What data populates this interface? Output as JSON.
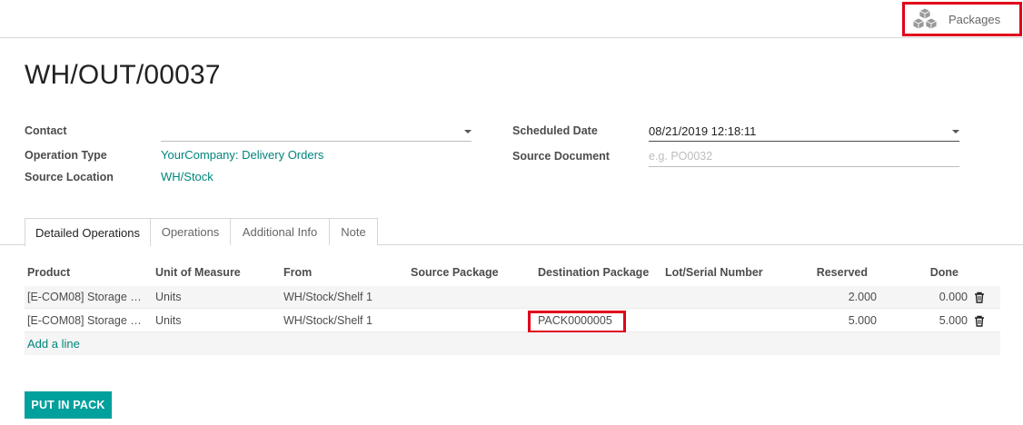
{
  "smart_button": {
    "label": "Packages",
    "icon": "cubes-icon"
  },
  "record": {
    "title": "WH/OUT/00037"
  },
  "form": {
    "contact": {
      "label": "Contact",
      "value": ""
    },
    "operation_type": {
      "label": "Operation Type",
      "value": "YourCompany: Delivery Orders"
    },
    "source_location": {
      "label": "Source Location",
      "value": "WH/Stock"
    },
    "scheduled_date": {
      "label": "Scheduled Date",
      "value": "08/21/2019 12:18:11"
    },
    "source_document": {
      "label": "Source Document",
      "value": "",
      "placeholder": "e.g. PO0032"
    }
  },
  "tabs": [
    {
      "label": "Detailed Operations",
      "active": true
    },
    {
      "label": "Operations",
      "active": false
    },
    {
      "label": "Additional Info",
      "active": false
    },
    {
      "label": "Note",
      "active": false
    }
  ],
  "table": {
    "columns": [
      "Product",
      "Unit of Measure",
      "From",
      "Source Package",
      "Destination Package",
      "Lot/Serial Number",
      "Reserved",
      "Done"
    ],
    "rows": [
      {
        "product": "[E-COM08] Storage B…",
        "uom": "Units",
        "from": "WH/Stock/Shelf 1",
        "source_package": "",
        "destination_package": "",
        "lot": "",
        "reserved": "2.000",
        "done": "0.000"
      },
      {
        "product": "[E-COM08] Storage B…",
        "uom": "Units",
        "from": "WH/Stock/Shelf 1",
        "source_package": "",
        "destination_package": "PACK0000005",
        "lot": "",
        "reserved": "5.000",
        "done": "5.000"
      }
    ],
    "add_line": "Add a line"
  },
  "actions": {
    "put_in_pack": "PUT IN PACK"
  },
  "colors": {
    "accent": "#00a09d",
    "link": "#00857b",
    "highlight": "#e0001b"
  }
}
